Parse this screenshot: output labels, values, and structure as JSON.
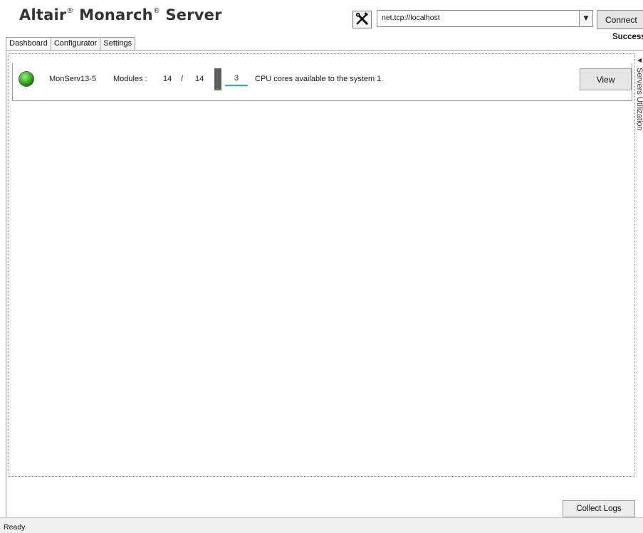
{
  "header": {
    "app_name_part1": "Altair",
    "reg_mark": "®",
    "app_name_part2": "Monarch",
    "app_name_part3": "Server",
    "tools_icon": "wrench-screwdriver-icon",
    "server_address": "net.tcp://localhost",
    "connect_label": "Connect",
    "connection_status": "Success"
  },
  "tabs": [
    {
      "label": "Dashboard",
      "active": true
    },
    {
      "label": "Configurator",
      "active": false
    },
    {
      "label": "Settings",
      "active": false
    }
  ],
  "dashboard": {
    "server": {
      "status_icon": "status-led-green",
      "status_color": "#3cb221",
      "name": "MonServ13-5",
      "modules_label": "Modules :",
      "modules_running": "14",
      "modules_separator": "/",
      "modules_total": "14",
      "cores_value": "3",
      "cores_text": "CPU cores available to the system 1.",
      "view_label": "View"
    },
    "side_panel_label": "Servers Utilization",
    "side_panel_icon": "collapse-arrow-icon",
    "collect_logs_label": "Collect Logs"
  },
  "statusbar": {
    "text": "Ready"
  },
  "colors": {
    "accent_underline": "#2aa7c8",
    "status_ok": "#3cb221"
  }
}
